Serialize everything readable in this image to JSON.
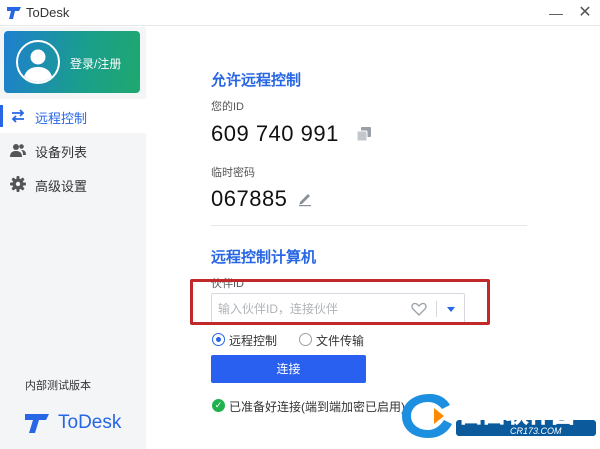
{
  "window": {
    "title": "ToDesk",
    "minimize_symbol": "—",
    "close_symbol": "✕"
  },
  "sidebar": {
    "login_label": "登录/注册",
    "items": [
      {
        "label": "远程控制",
        "icon": "swap-arrows-icon",
        "active": true
      },
      {
        "label": "设备列表",
        "icon": "users-icon",
        "active": false
      },
      {
        "label": "高级设置",
        "icon": "gear-icon",
        "active": false
      }
    ],
    "version_label": "内部测试版本",
    "brand_name": "ToDesk"
  },
  "allow_section": {
    "title": "允许远程控制",
    "id_label": "您的ID",
    "id_value": "609 740 991",
    "password_label": "临时密码",
    "password_value": "067885"
  },
  "control_section": {
    "title": "远程控制计算机",
    "partner_label": "伙伴ID",
    "partner_placeholder": "输入伙伴ID，连接伙伴",
    "partner_value": "",
    "modes": [
      {
        "label": "远程控制",
        "selected": true
      },
      {
        "label": "文件传输",
        "selected": false
      }
    ],
    "connect_label": "连接",
    "status_text": "已准备好连接(端到端加密已启用)"
  },
  "watermark": {
    "text": "西西软件园",
    "site": "CR173.COM"
  },
  "colors": {
    "accent": "#2766e4",
    "button": "#2a60f0",
    "highlight_frame": "#c0282a",
    "status_ok": "#22b14c"
  }
}
